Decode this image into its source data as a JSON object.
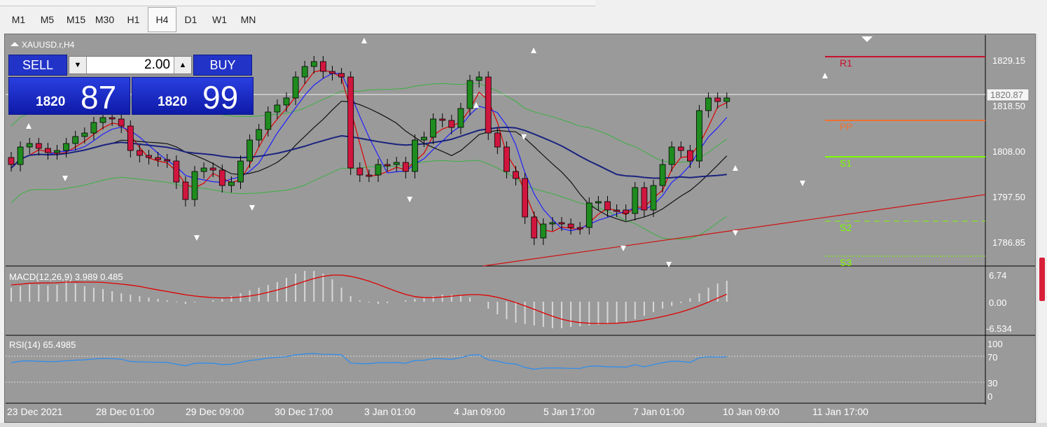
{
  "timeframes": [
    {
      "label": "M1",
      "active": false
    },
    {
      "label": "M5",
      "active": false
    },
    {
      "label": "M15",
      "active": false
    },
    {
      "label": "M30",
      "active": false
    },
    {
      "label": "H1",
      "active": false
    },
    {
      "label": "H4",
      "active": true
    },
    {
      "label": "D1",
      "active": false
    },
    {
      "label": "W1",
      "active": false
    },
    {
      "label": "MN",
      "active": false
    }
  ],
  "chart": {
    "symbol_label": "XAUUSD.r,H4",
    "price_axis": [
      "1829.15",
      "1818.50",
      "1808.00",
      "1797.50",
      "1786.85"
    ],
    "current_price": "1820.87",
    "pivot_labels": {
      "r1": "R1",
      "pp": "PP",
      "s1": "S1",
      "s2": "S2",
      "s3": "S3"
    },
    "time_axis": [
      "23 Dec 2021",
      "28 Dec 01:00",
      "29 Dec 09:00",
      "30 Dec 17:00",
      "3 Jan 01:00",
      "4 Jan 09:00",
      "5 Jan 17:00",
      "7 Jan 01:00",
      "10 Jan 09:00",
      "11 Jan 17:00"
    ]
  },
  "one_click": {
    "sell_label": "SELL",
    "buy_label": "BUY",
    "lot_value": "2.00",
    "sell_price_small": "1820",
    "sell_price_big": "87",
    "buy_price_small": "1820",
    "buy_price_big": "99"
  },
  "macd": {
    "label": "MACD(12,26,9) 3.989 0.485",
    "axis": [
      "6.74",
      "0.00",
      "-6.534"
    ]
  },
  "rsi": {
    "label": "RSI(14) 65.4985",
    "axis": [
      "100",
      "70",
      "30",
      "0"
    ]
  },
  "colors": {
    "chart_bg": "#9a9a9a",
    "bull": "#1e8c1e",
    "bear": "#d0163e",
    "ma_slow": "#1a237e",
    "r1": "#c8102e",
    "pp": "#f07030",
    "support": "#7cfc00",
    "rsi_line": "#2a8cf0",
    "macd_signal": "#e00000"
  }
}
